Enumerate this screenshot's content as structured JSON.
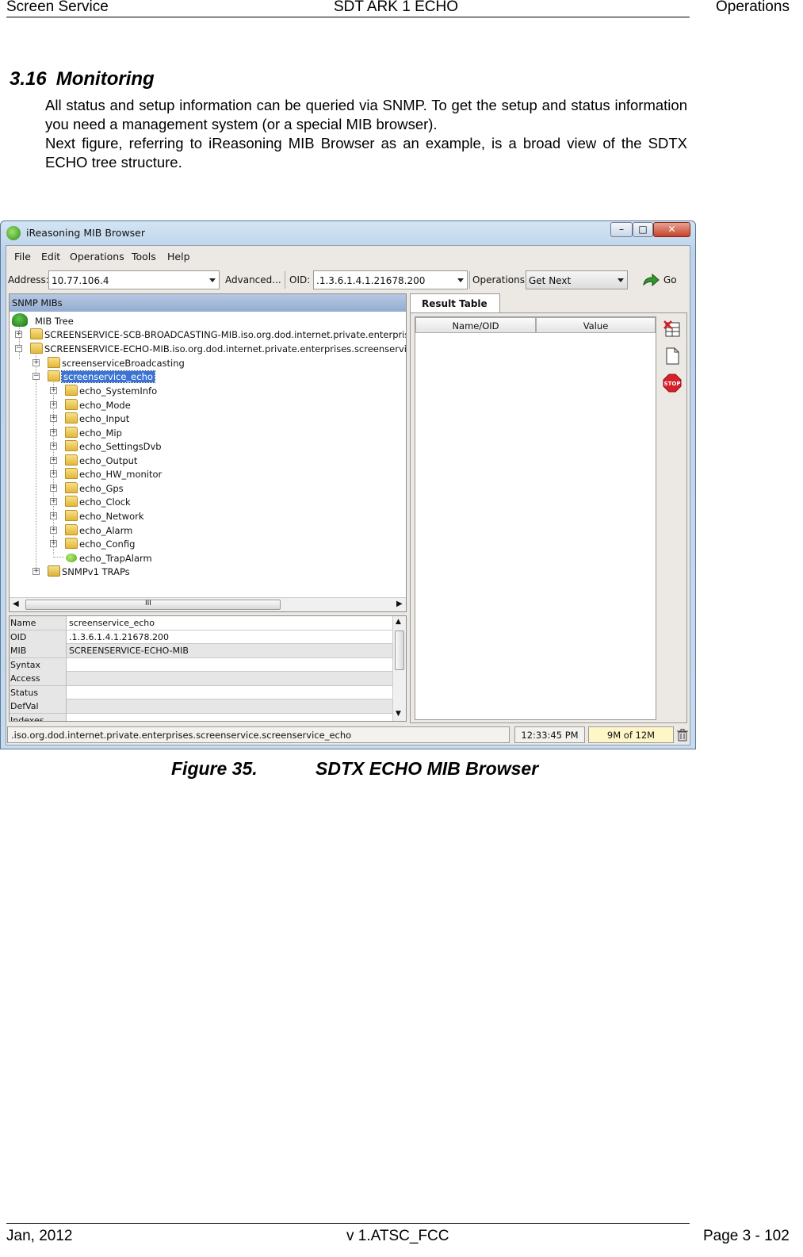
{
  "page_header": {
    "left": "Screen Service",
    "center": "SDT ARK 1 ECHO",
    "right": "Operations"
  },
  "section": {
    "number": "3.16",
    "title": "Monitoring"
  },
  "paragraphs": [
    "All status and setup information can be queried via SNMP. To get the setup and status information you need a management system (or a special MIB browser).",
    "Next figure, referring to iReasoning MIB Browser as an example, is a broad view of the SDTX ECHO tree structure."
  ],
  "screenshot": {
    "window_title": "iReasoning MIB Browser",
    "window_controls": [
      "–",
      "□",
      "✕"
    ],
    "menu": [
      "File",
      "Edit",
      "Operations",
      "Tools",
      "Help"
    ],
    "toolbar": {
      "address_label": "Address:",
      "address_value": "10.77.106.4",
      "advanced_label": "Advanced...",
      "oid_label": "OID:",
      "oid_value": ".1.3.6.1.4.1.21678.200",
      "operations_label": "Operations:",
      "operations_value": "Get Next",
      "go_label": "Go"
    },
    "mib_panel_title": "SNMP MIBs",
    "tree": {
      "root": "MIB Tree",
      "nodes": [
        "SCREENSERVICE-SCB-BROADCASTING-MIB.iso.org.dod.internet.private.enterprises.s",
        "SCREENSERVICE-ECHO-MIB.iso.org.dod.internet.private.enterprises.screenservice",
        "screenserviceBroadcasting",
        "screenservice_echo",
        "echo_SystemInfo",
        "echo_Mode",
        "echo_Input",
        "echo_Mip",
        "echo_SettingsDvb",
        "echo_Output",
        "echo_HW_monitor",
        "echo_Gps",
        "echo_Clock",
        "echo_Network",
        "echo_Alarm",
        "echo_Config",
        "echo_TrapAlarm",
        "SNMPv1 TRAPs"
      ],
      "scroll_grip": "III"
    },
    "properties": [
      {
        "name": "Name",
        "value": "screenservice_echo"
      },
      {
        "name": "OID",
        "value": ".1.3.6.1.4.1.21678.200"
      },
      {
        "name": "MIB",
        "value": "SCREENSERVICE-ECHO-MIB"
      },
      {
        "name": "Syntax",
        "value": ""
      },
      {
        "name": "Access",
        "value": ""
      },
      {
        "name": "Status",
        "value": ""
      },
      {
        "name": "DefVal",
        "value": ""
      },
      {
        "name": "Indexes",
        "value": ""
      }
    ],
    "result_tab": "Result Table",
    "result_columns": [
      "Name/OID",
      "Value"
    ],
    "stop_label": "STOP",
    "status": {
      "path": ".iso.org.dod.internet.private.enterprises.screenservice.screenservice_echo",
      "time": "12:33:45 PM",
      "memory": "9M of 12M"
    }
  },
  "figure_caption": {
    "label": "Figure 35.",
    "title": "SDTX ECHO MIB Browser"
  },
  "page_footer": {
    "left": "Jan, 2012",
    "center": "v 1.ATSC_FCC",
    "right": "Page 3 - 102"
  }
}
